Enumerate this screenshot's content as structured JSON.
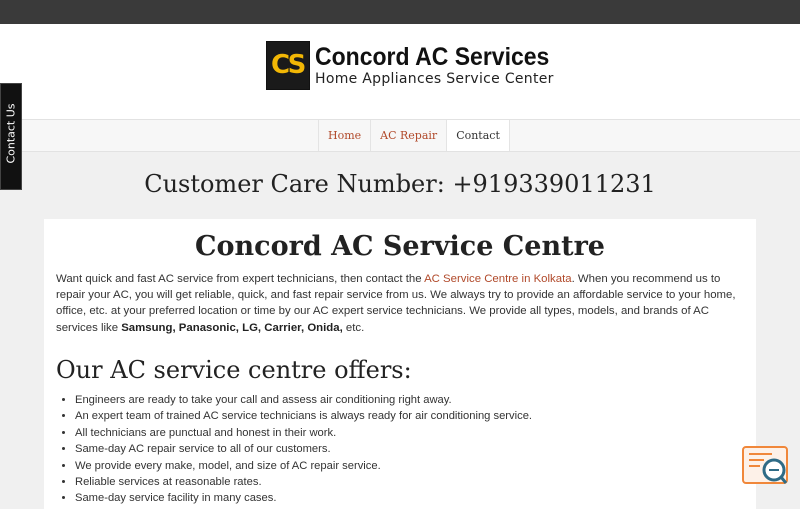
{
  "site": {
    "logo_mark": "CS",
    "title": "Concord AC Services",
    "subtitle": "Home Appliances Service Center"
  },
  "nav": {
    "items": [
      {
        "label": "Home"
      },
      {
        "label": "AC Repair"
      },
      {
        "label": "Contact"
      }
    ],
    "current": "Contact"
  },
  "side_tab": {
    "label": "Contact Us"
  },
  "customer_care": "Customer Care Number: +919339011231",
  "main": {
    "heading": "Concord AC Service Centre",
    "intro": {
      "p1": "Want quick and fast AC service from expert technicians, then contact the ",
      "link": "AC Service Centre in Kolkata",
      "p2": ". When you recommend us to repair your AC, you will get reliable, quick, and fast repair service from us. We always try to provide an affordable service to your home, office, etc. at your preferred location or time by our AC expert service technicians. We provide all types, models, and brands of AC services like ",
      "brands1": "Samsung, Panasonic, LG, Carrier, Onida,",
      "p3": " etc."
    },
    "offers_heading": "Our AC service centre offers:",
    "offers": [
      "Engineers are ready to take your call and assess air conditioning right away.",
      "An expert team of trained AC service technicians is always ready for air conditioning service.",
      "All technicians are punctual and honest in their work.",
      "Same-day AC repair service to all of our customers.",
      "We provide every make, model, and size of AC repair service.",
      "Reliable services at reasonable rates.",
      "Same-day service facility in many cases."
    ]
  },
  "colors": {
    "accent": "#b14a2b",
    "topbar": "#3a3a3a",
    "logo_yellow": "#f2b705",
    "widget_orange": "#f0873a"
  },
  "icons": {
    "widget": "chat-search-icon"
  }
}
